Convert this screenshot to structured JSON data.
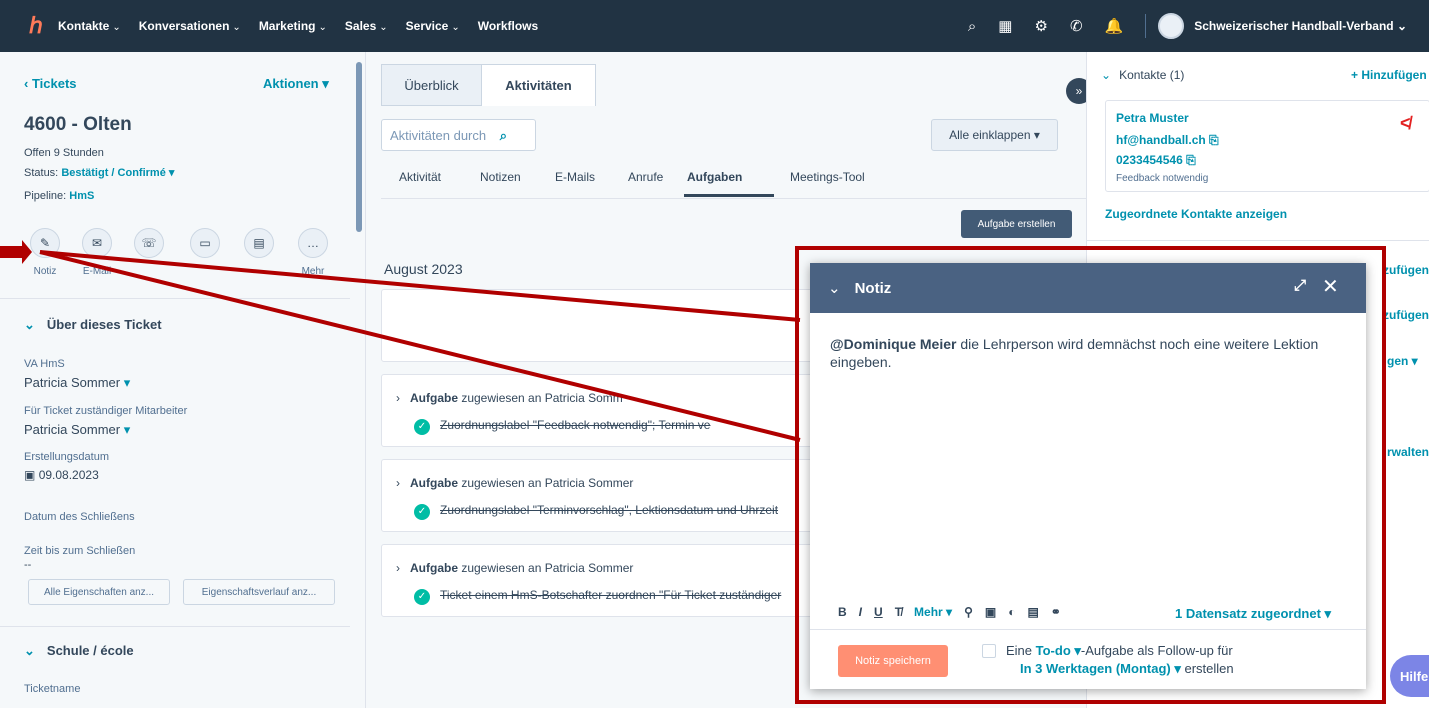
{
  "nav": {
    "items": [
      "Kontakte",
      "Konversationen",
      "Marketing",
      "Sales",
      "Service",
      "Workflows"
    ],
    "account": "Schweizerischer Handball-Verband"
  },
  "left": {
    "back": "‹ Tickets",
    "actions": "Aktionen",
    "title": "4600 - Olten",
    "open_for": "Offen 9 Stunden",
    "status_label": "Status:",
    "status_value": "Bestätigt / Confirmé",
    "pipeline_label": "Pipeline:",
    "pipeline_value": "HmS",
    "action_labels": [
      "Notiz",
      "E-Mail",
      "Mehr"
    ],
    "section_about": "Über dieses Ticket",
    "field_va": "VA HmS",
    "field_va_value": "Patricia Sommer",
    "field_owner": "Für Ticket zuständiger Mitarbeiter",
    "field_owner_value": "Patricia Sommer",
    "field_created": "Erstellungsdatum",
    "field_created_value": "09.08.2023",
    "field_closed": "Datum des Schließens",
    "field_time_close": "Zeit bis zum Schließen",
    "field_time_close_value": "--",
    "btn_all_props": "Alle Eigenschaften anz...",
    "btn_history": "Eigenschaftsverlauf anz...",
    "section_school": "Schule / école",
    "field_ticketname": "Ticketname"
  },
  "middle": {
    "tab_overview": "Überblick",
    "tab_activities": "Aktivitäten",
    "search_placeholder": "Aktivitäten durch",
    "collapse_all": "Alle einklappen",
    "subtabs": [
      "Aktivität",
      "Notizen",
      "E-Mails",
      "Anrufe",
      "Aufgaben",
      "Meetings-Tool"
    ],
    "create_task": "Aufgabe erstellen",
    "month": "August 2023",
    "tasks": [
      {
        "title_bold": "Aufgabe",
        "title_rest": " zugewiesen an Patricia Somm",
        "detail": "Zuordnungslabel \"Feedback notwendig\"; Termin ve"
      },
      {
        "title_bold": "Aufgabe",
        "title_rest": " zugewiesen an Patricia Sommer",
        "detail": "Zuordnungslabel \"Terminvorschlag\", Lektionsdatum und Uhrzeit"
      },
      {
        "title_bold": "Aufgabe",
        "title_rest": " zugewiesen an Patricia Sommer",
        "detail": "Ticket einem HmS-Botschafter zuordnen \"Für Ticket zuständiger"
      }
    ]
  },
  "right": {
    "contacts_header": "Kontakte (1)",
    "add": "+ Hinzufügen",
    "contact_name": "Petra Muster",
    "contact_email": "hf@handball.ch",
    "contact_phone": "0233454546",
    "contact_label": "Feedback notwendig",
    "show_assigned": "Zugeordnete Kontakte anzeigen",
    "partial_1": "zufügen",
    "partial_2": "zufügen",
    "partial_3": "gen",
    "partial_4": "rwalten"
  },
  "modal": {
    "title": "Notiz",
    "mention": "@Dominique Meier",
    "body": " die Lehrperson wird demnächst noch eine weitere Lektion eingeben.",
    "toolbar_more": "Mehr",
    "record_link": "1 Datensatz zugeordnet",
    "save": "Notiz speichern",
    "followup_pre": "Eine ",
    "followup_todo": "To-do",
    "followup_mid": "-Aufgabe als Follow-up für",
    "followup_when": "In 3 Werktagen (Montag)",
    "followup_post": "erstellen"
  },
  "help": "Hilfe",
  "colors": {
    "nav": "#213343",
    "accent": "#0091ae",
    "highlight": "#b00000",
    "save": "#ff8f73"
  }
}
